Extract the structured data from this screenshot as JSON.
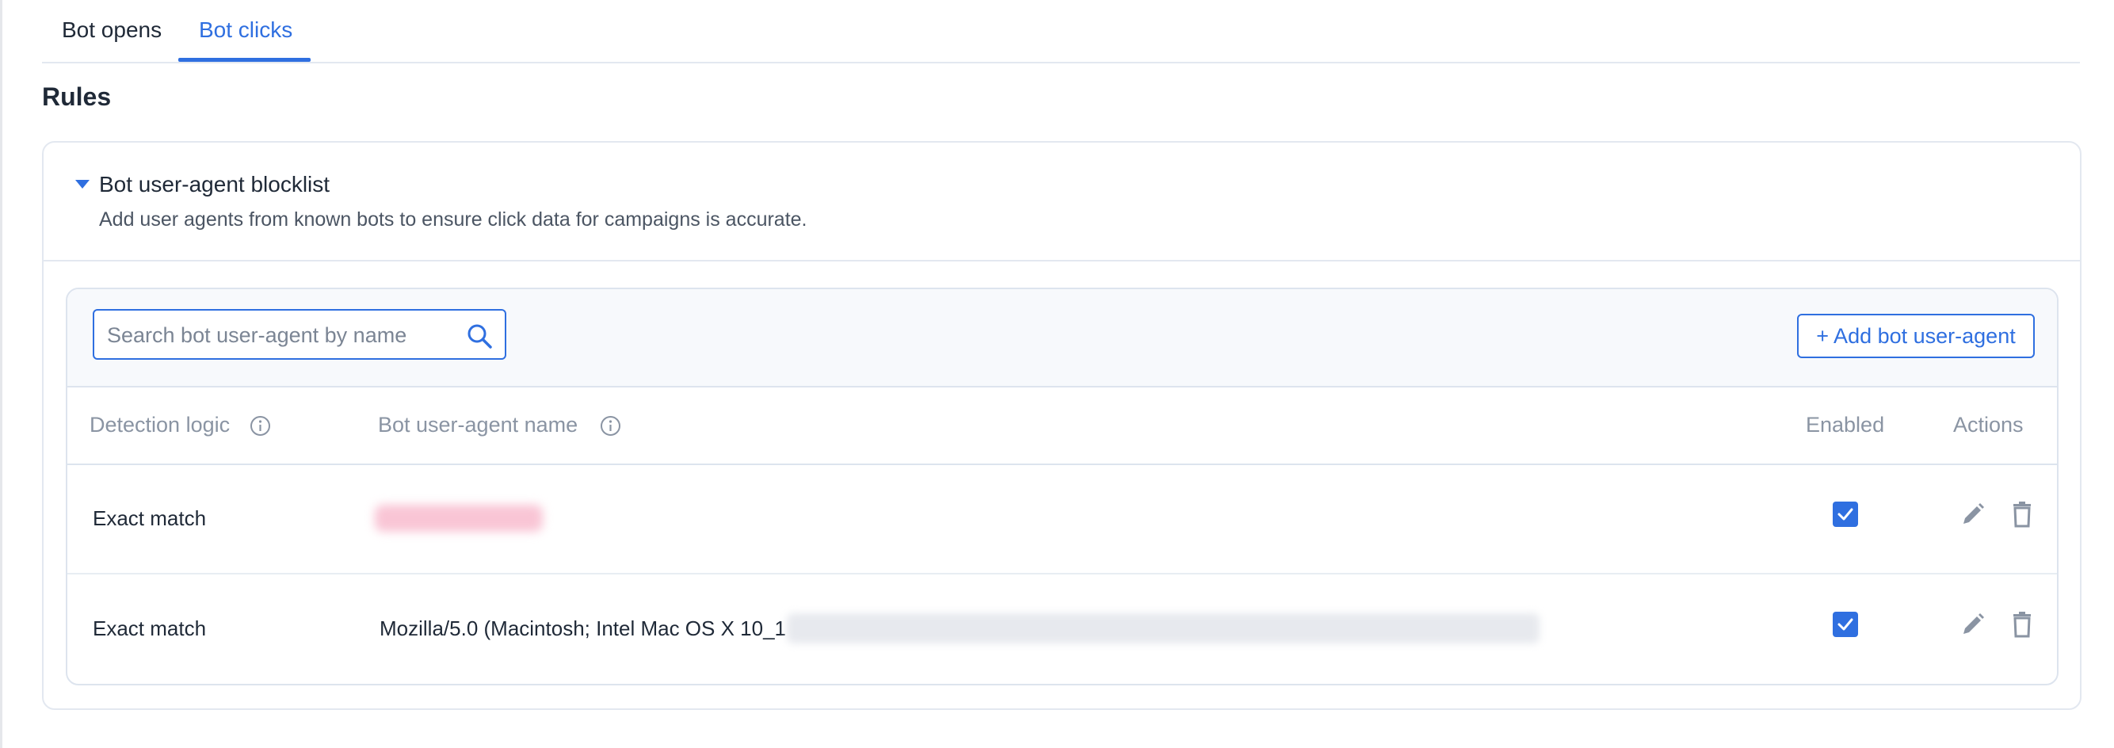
{
  "tabs": [
    {
      "label": "Bot opens",
      "active": false
    },
    {
      "label": "Bot clicks",
      "active": true
    }
  ],
  "section_title": "Rules",
  "blocklist": {
    "title": "Bot user-agent blocklist",
    "description": "Add user agents from known bots to ensure click data for campaigns is accurate.",
    "search": {
      "placeholder": "Search bot user-agent by name",
      "value": ""
    },
    "add_button_label": "+ Add bot user-agent",
    "columns": {
      "detection_logic": "Detection logic",
      "name": "Bot user-agent name",
      "enabled": "Enabled",
      "actions": "Actions"
    },
    "rows": [
      {
        "detection_logic": "Exact match",
        "name": "",
        "name_redacted": true,
        "enabled": true
      },
      {
        "detection_logic": "Exact match",
        "name": "Mozilla/5.0 (Macintosh; Intel Mac OS X 10_1",
        "name_redacted": true,
        "enabled": true
      }
    ]
  },
  "colors": {
    "accent": "#2f6fe0",
    "muted_text": "#8a94a3",
    "border": "#e3e8f0",
    "toolbar_bg": "#f7f9fc"
  },
  "icons": [
    "caret-down-icon",
    "search-icon",
    "info-icon",
    "checkbox-checked-icon",
    "pencil-icon",
    "trash-icon"
  ]
}
